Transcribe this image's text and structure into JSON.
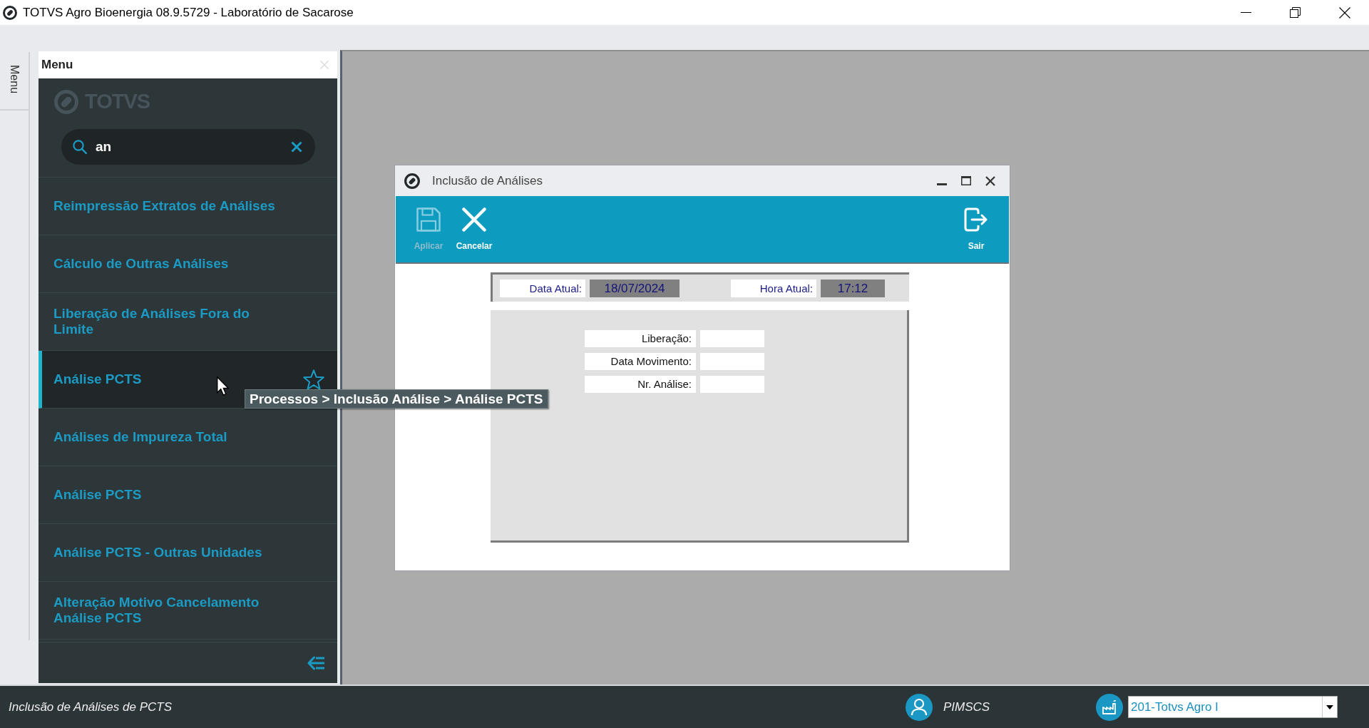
{
  "window": {
    "title": "TOTVS Agro Bioenergia 08.9.5729 - Laboratório de Sacarose"
  },
  "side_tab": {
    "label": "Menu"
  },
  "menu": {
    "title": "Menu",
    "logo": "TOTVS",
    "search": {
      "value": "an"
    },
    "items": [
      {
        "label": "Reimpressão Extratos de Análises",
        "selected": false
      },
      {
        "label": "Cálculo de Outras Análises",
        "selected": false
      },
      {
        "label": "Liberação de Análises Fora do Limite",
        "selected": false
      },
      {
        "label": "Análise PCTS",
        "selected": true
      },
      {
        "label": "Análises de Impureza Total",
        "selected": false
      },
      {
        "label": "Análise PCTS",
        "selected": false
      },
      {
        "label": "Análise PCTS - Outras Unidades",
        "selected": false
      },
      {
        "label": "Alteração Motivo Cancelamento Análise PCTS",
        "selected": false
      }
    ]
  },
  "tooltip": {
    "text": "Processos > Inclusão Análise > Análise PCTS"
  },
  "dialog": {
    "title": "Inclusão de Análises",
    "toolbar": [
      {
        "kind": "save",
        "label": "Aplicar",
        "disabled": true
      },
      {
        "kind": "cancel",
        "label": "Cancelar",
        "disabled": false
      },
      {
        "kind": "exit",
        "label": "Sair",
        "disabled": false
      }
    ],
    "header_fields": [
      {
        "label": "Data Atual:",
        "value": "18/07/2024"
      },
      {
        "label": "Hora Atual:",
        "value": "17:12"
      }
    ],
    "fields": [
      {
        "label": "Liberação:"
      },
      {
        "label": "Data Movimento:"
      },
      {
        "label": "Nr. Análise:"
      }
    ]
  },
  "status_bar": {
    "message": "Inclusão de Análises de PCTS",
    "user": "PIMSCS",
    "company": {
      "value": "201-Totvs Agro I"
    }
  }
}
